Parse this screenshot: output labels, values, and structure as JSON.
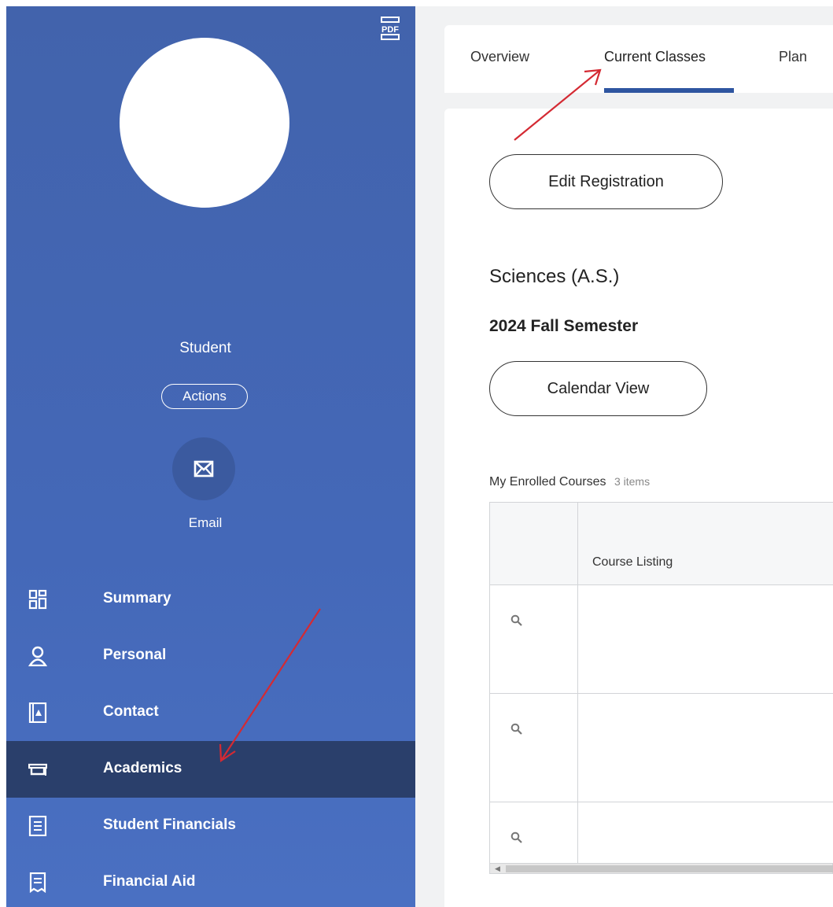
{
  "sidebar": {
    "student_name": "Student",
    "actions_label": "Actions",
    "email_label": "Email",
    "pdf_icon": "pdf-icon",
    "nav_items": [
      {
        "label": "Summary",
        "icon": "grid-icon"
      },
      {
        "label": "Personal",
        "icon": "person-icon"
      },
      {
        "label": "Contact",
        "icon": "contact-book-icon"
      },
      {
        "label": "Academics",
        "icon": "graduation-cap-icon",
        "active": true
      },
      {
        "label": "Student Financials",
        "icon": "ledger-icon"
      },
      {
        "label": "Financial Aid",
        "icon": "receipt-icon"
      }
    ],
    "colors": {
      "sidebar": "#4468b8",
      "active_item": "#2a3f6b"
    }
  },
  "tabs": [
    {
      "label": "Overview"
    },
    {
      "label": "Current Classes",
      "active": true
    },
    {
      "label": "Plan"
    }
  ],
  "main": {
    "edit_registration_label": "Edit Registration",
    "program_title": "Sciences (A.S.)",
    "semester_title": "2024 Fall Semester",
    "calendar_view_label": "Calendar View",
    "courses_header": "My Enrolled Courses",
    "courses_count": "3 items",
    "columns": [
      "Course Listing"
    ],
    "rows": [
      {
        "listing": ""
      },
      {
        "listing": ""
      },
      {
        "listing": ""
      }
    ]
  },
  "annotations": {
    "arrow_color": "#d42a33"
  }
}
